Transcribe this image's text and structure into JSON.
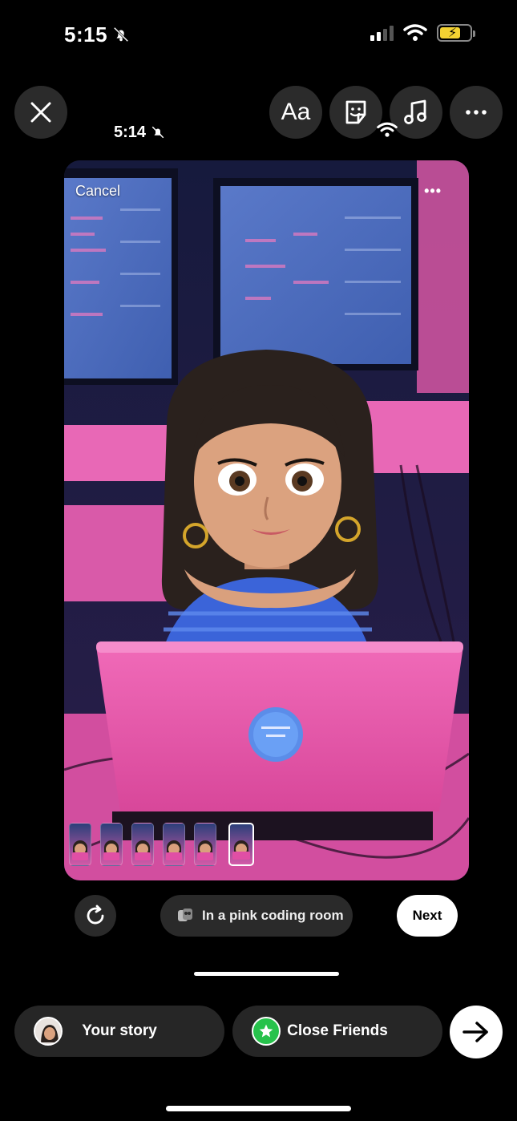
{
  "status_bar": {
    "time": "5:15"
  },
  "toolbar": {
    "text_tool_label": "Aa"
  },
  "inner_status": {
    "time": "5:14"
  },
  "canvas": {
    "cancel_label": "Cancel",
    "more_label": "•••",
    "thumbnail_count": 6,
    "selected_thumbnail": 6
  },
  "controls": {
    "prompt_label": "In a pink coding room",
    "next_label": "Next"
  },
  "share": {
    "your_story_label": "Your story",
    "close_friends_label": "Close Friends"
  },
  "colors": {
    "accent_pink": "#e04fa5",
    "close_friends_green": "#27c24c",
    "battery_yellow": "#f3d232"
  },
  "icons": [
    "bell-off-icon",
    "signal-icon",
    "wifi-icon",
    "battery-charging-icon",
    "close-icon",
    "text-icon",
    "sticker-icon",
    "music-note-icon",
    "more-icon",
    "regenerate-icon",
    "prompt-icon",
    "star-icon",
    "arrow-right-icon"
  ]
}
